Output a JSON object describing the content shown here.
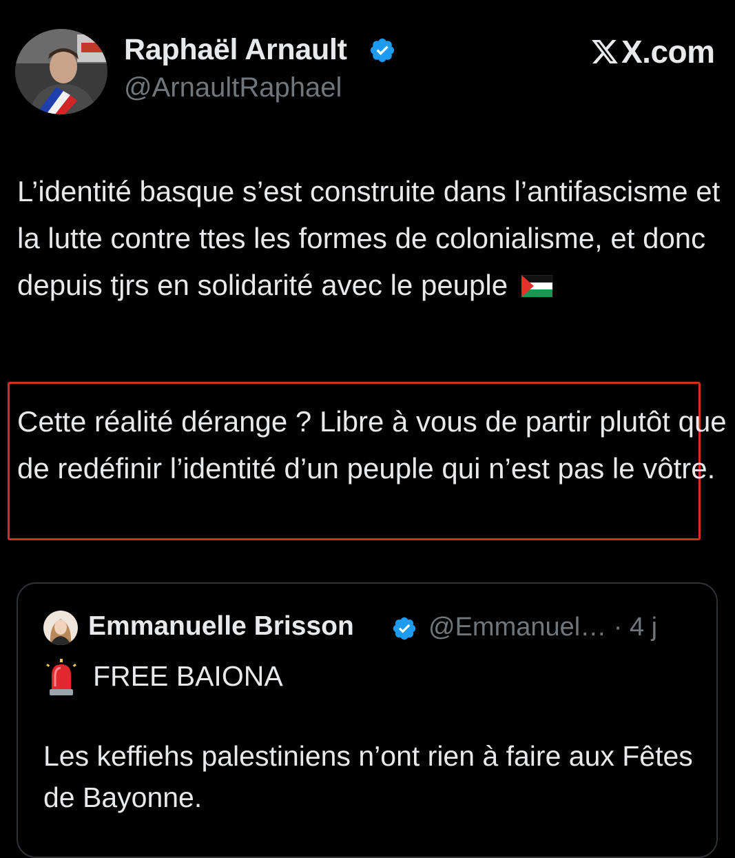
{
  "tweet": {
    "author": {
      "name": "Raphaël Arnault",
      "handle": "@ArnaultRaphael",
      "verified": true
    },
    "brand": "X.com",
    "body_main": "L’identité basque s’est construite dans l’antifascisme et la lutte contre ttes les formes de colonialisme, et donc depuis tjrs en solidarité avec le peuple",
    "flag_emoji": "palestine-flag-icon",
    "body_highlighted": "Cette réalité dérange ? Libre à vous de partir plutôt que de redéfinir l’identité d’un peuple qui n’est pas le vôtre.",
    "highlight_color": "#d0311f"
  },
  "quoted_tweet": {
    "author": {
      "name": "Emmanuelle Brisson",
      "handle": "@Emmanuel… · 4 j",
      "verified": true
    },
    "siren_icon": "rotating-light-icon",
    "line1": "FREE BAIONA",
    "body": "Les keffiehs palestiniens n’ont rien à faire aux Fêtes de Bayonne."
  },
  "colors": {
    "background": "#000000",
    "text": "#e7e9ea",
    "secondary_text": "#71767b",
    "verified_blue": "#1d9bf0",
    "card_border": "#2f3336"
  }
}
